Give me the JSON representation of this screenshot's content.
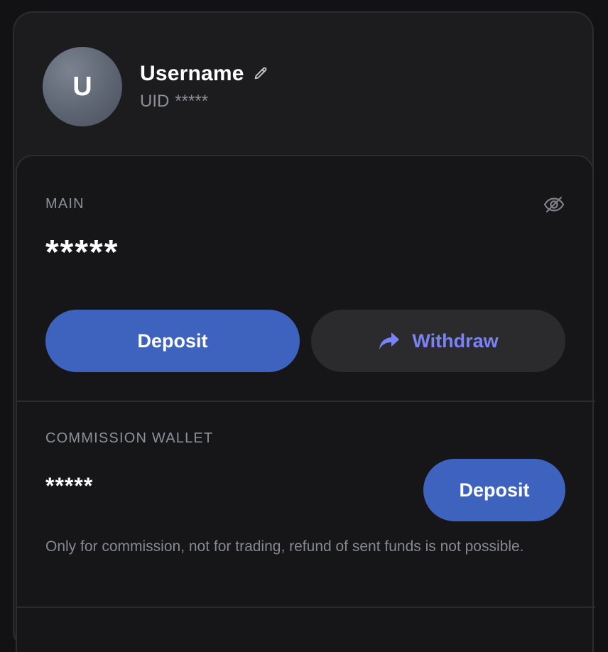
{
  "profile": {
    "avatar_initial": "U",
    "username": "Username",
    "uid_label": "UID",
    "uid_value": "*****"
  },
  "main_wallet": {
    "label": "MAIN",
    "balance": "*****",
    "deposit_label": "Deposit",
    "withdraw_label": "Withdraw"
  },
  "commission_wallet": {
    "label": "COMMISSION WALLET",
    "balance": "*****",
    "deposit_label": "Deposit",
    "note": "Only for commission, not for trading, refund of sent funds is not possible."
  },
  "icons": {
    "edit": "pencil-icon",
    "visibility": "eye-off-icon",
    "withdraw": "share-arrow-icon"
  },
  "colors": {
    "primary_button": "#3d63be",
    "withdraw_text": "#7a83f5",
    "background": "#1c1c1f"
  }
}
